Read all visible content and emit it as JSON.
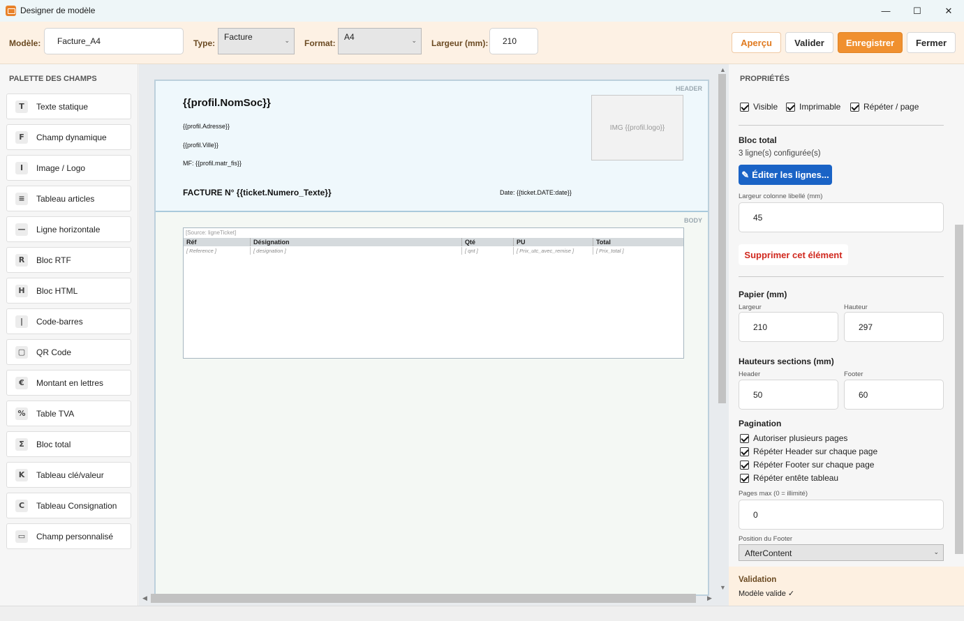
{
  "window": {
    "title": "Designer de modèle",
    "minimize": "—",
    "maximize": "☐",
    "close": "✕"
  },
  "toolbar": {
    "modele_label": "Modèle:",
    "modele_value": "Facture_A4",
    "type_label": "Type:",
    "type_value": "Facture",
    "format_label": "Format:",
    "format_value": "A4",
    "largeur_label": "Largeur (mm):",
    "largeur_value": "210",
    "apercu": "Aperçu",
    "valider": "Valider",
    "enregistrer": "Enregistrer",
    "fermer": "Fermer"
  },
  "palette": {
    "title": "PALETTE DES CHAMPS",
    "items": [
      {
        "icon": "T",
        "label": "Texte statique"
      },
      {
        "icon": "F",
        "label": "Champ dynamique"
      },
      {
        "icon": "I",
        "label": "Image / Logo"
      },
      {
        "icon": "≡",
        "label": "Tableau articles"
      },
      {
        "icon": "—",
        "label": "Ligne horizontale"
      },
      {
        "icon": "R",
        "label": "Bloc RTF"
      },
      {
        "icon": "H",
        "label": "Bloc HTML"
      },
      {
        "icon": "|",
        "label": "Code-barres"
      },
      {
        "icon": "▢",
        "label": "QR Code"
      },
      {
        "icon": "€",
        "label": "Montant en lettres"
      },
      {
        "icon": "%",
        "label": "Table TVA"
      },
      {
        "icon": "Σ",
        "label": "Bloc total"
      },
      {
        "icon": "K",
        "label": "Tableau clé/valeur"
      },
      {
        "icon": "C",
        "label": "Tableau Consignation"
      },
      {
        "icon": "▭",
        "label": "Champ personnalisé"
      }
    ]
  },
  "canvas": {
    "header_tag": "HEADER",
    "body_tag": "BODY",
    "nom_soc": "{{profil.NomSoc}}",
    "adresse": "{{profil.Adresse}}",
    "ville": "{{profil.Ville}}",
    "matr_fis": "MF: {{profil.matr_fis}}",
    "logo": "IMG {{profil.logo}}",
    "facture_no": "FACTURE N° {{ticket.Numero_Texte}}",
    "date": "Date: {{ticket.DATE:date}}",
    "table": {
      "source": "[Source: ligneTicket]",
      "columns": [
        "Réf",
        "Désignation",
        "Qté",
        "PU",
        "Total"
      ],
      "row": [
        "[ Reference ]",
        "[ designation ]",
        "[ qnt ]",
        "[ Prix_utc_avec_remise ]",
        "[ Prix_total ]"
      ]
    }
  },
  "props": {
    "title": "PROPRIÉTÉS",
    "visible": "Visible",
    "imprimable": "Imprimable",
    "repeter_page": "Répéter / page",
    "bloc_title": "Bloc total",
    "bloc_lines": "3 ligne(s) configurée(s)",
    "edit_lines": "Éditer les lignes...",
    "largeur_col_label": "Largeur colonne libellé (mm)",
    "largeur_col_value": "45",
    "delete": "Supprimer cet élément",
    "papier_title": "Papier (mm)",
    "papier_largeur_label": "Largeur",
    "papier_largeur_value": "210",
    "papier_hauteur_label": "Hauteur",
    "papier_hauteur_value": "297",
    "hauteurs_title": "Hauteurs sections (mm)",
    "header_label": "Header",
    "header_value": "50",
    "footer_label": "Footer",
    "footer_value": "60",
    "pagination_title": "Pagination",
    "pag_multi": "Autoriser plusieurs pages",
    "pag_header": "Répéter Header sur chaque page",
    "pag_footer": "Répéter Footer sur chaque page",
    "pag_entete": "Répéter entête tableau",
    "pages_max_label": "Pages max (0 = illimité)",
    "pages_max_value": "0",
    "footer_pos_label": "Position du Footer",
    "footer_pos_value": "AfterContent"
  },
  "validation": {
    "title": "Validation",
    "status": "Modèle valide ✓"
  }
}
